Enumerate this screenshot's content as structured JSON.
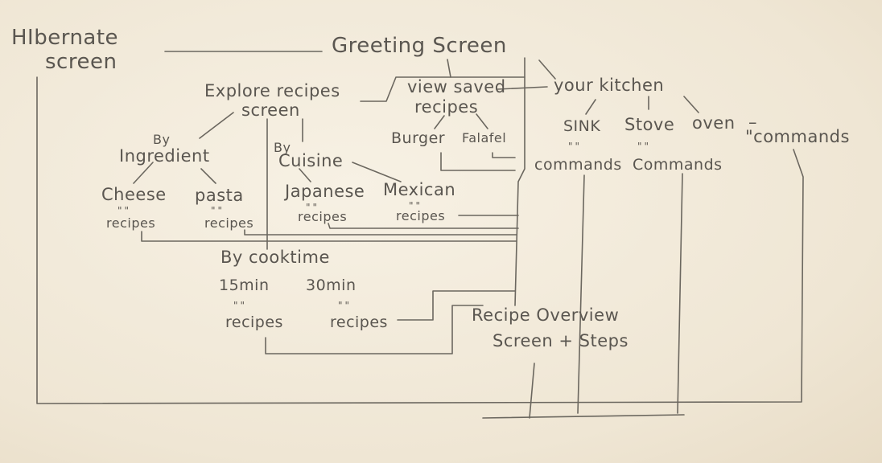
{
  "diagram": {
    "ink_color": "#5a5650",
    "nodes": {
      "hibernate_1": "HIbernate",
      "hibernate_2": "screen",
      "greeting": "Greeting Screen",
      "explore_1": "Explore recipes",
      "explore_2": "screen",
      "saved_1": "view saved",
      "saved_2": "recipes",
      "kitchen": "your kitchen",
      "by_small": "By",
      "ingredient": "Ingredient",
      "cuisine_by": "By",
      "cuisine": "Cuisine",
      "burger": "Burger",
      "falafel": "Falafel",
      "sink": "SINK",
      "stove": "Stove",
      "oven": "oven",
      "oven_dash": "–",
      "commands_right": "\"commands",
      "commands_sink": "commands",
      "commands_stove": "Commands",
      "cheese": "Cheese",
      "pasta": "pasta",
      "japanese": "Japanese",
      "mexican": "Mexican",
      "recipes_cheese": "recipes",
      "recipes_pasta": "recipes",
      "recipes_japanese": "recipes",
      "recipes_mexican": "recipes",
      "cooktime": "By cooktime",
      "min15": "15min",
      "min30": "30min",
      "recipes_15": "recipes",
      "recipes_30": "recipes",
      "overview_1": "Recipe Overview",
      "overview_2": "Screen + Steps"
    },
    "ditto_marks": {
      "cheese": "\"\"",
      "pasta": "\"\"",
      "japanese": "\"\"",
      "mexican": "\"\"",
      "sink": "\"\"",
      "stove": "\"\"",
      "min15": "\"\"",
      "min30": "\"\""
    }
  }
}
